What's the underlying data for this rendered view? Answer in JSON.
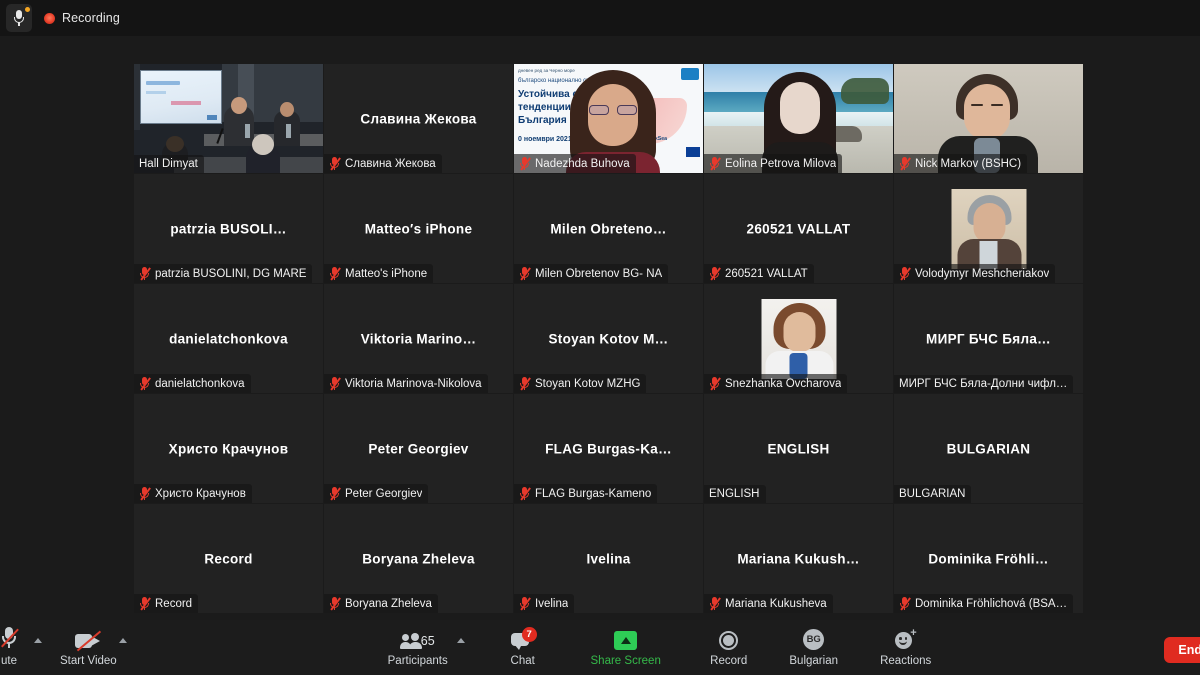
{
  "topbar": {
    "mic_icon": "microphone-icon",
    "recording_dot": "recording-dot-icon",
    "recording_label": "Recording"
  },
  "colors": {
    "active_speaker_border": "#d9e84f",
    "mute_red": "#e8392c",
    "share_green": "#2ecc56",
    "badge_red": "#e02b20",
    "tile_bg": "#222222"
  },
  "gallery": {
    "columns": 5,
    "rows": 5,
    "tiles": [
      {
        "center_name": "",
        "label": "Hall Dimyat",
        "muted": false,
        "kind": "video-hall",
        "active_speaker": true
      },
      {
        "center_name": "Славина Жекова",
        "label": "Славина Жекова",
        "muted": true,
        "kind": "name",
        "active_speaker": false
      },
      {
        "center_name": "",
        "label": "Nadezhda Buhova",
        "muted": true,
        "kind": "video-nadezhda",
        "active_speaker": false
      },
      {
        "center_name": "",
        "label": "Eolina Petrova Milova",
        "muted": true,
        "kind": "video-eolina",
        "active_speaker": false
      },
      {
        "center_name": "",
        "label": "Nick Markov (BSHC)",
        "muted": true,
        "kind": "video-nick",
        "active_speaker": false
      },
      {
        "center_name": "patrzia  BUSOLI…",
        "label": "patrzia BUSOLINI, DG MARE",
        "muted": true,
        "kind": "name",
        "active_speaker": false
      },
      {
        "center_name": "Matteo′s iPhone",
        "label": "Matteo's iPhone",
        "muted": true,
        "kind": "name",
        "active_speaker": false
      },
      {
        "center_name": "Milen  Obreteno…",
        "label": "Milen Obretenov BG- NA",
        "muted": true,
        "kind": "name",
        "active_speaker": false
      },
      {
        "center_name": "260521  VALLAT",
        "label": "260521  VALLAT",
        "muted": true,
        "kind": "name",
        "active_speaker": false
      },
      {
        "center_name": "",
        "label": "Volodymyr Meshcheriakov",
        "muted": true,
        "kind": "photo-volodymyr",
        "active_speaker": false
      },
      {
        "center_name": "danielatchonkova",
        "label": "danielatchonkova",
        "muted": true,
        "kind": "name",
        "active_speaker": false
      },
      {
        "center_name": "Viktoria  Marino…",
        "label": "Viktoria Marinova-Nikolova",
        "muted": true,
        "kind": "name",
        "active_speaker": false
      },
      {
        "center_name": "Stoyan Kotov M…",
        "label": "Stoyan Kotov MZHG",
        "muted": true,
        "kind": "name",
        "active_speaker": false
      },
      {
        "center_name": "",
        "label": "Snezhanka Ovcharova",
        "muted": true,
        "kind": "photo-snezhanka",
        "active_speaker": false
      },
      {
        "center_name": "МИРГ БЧС Бяла…",
        "label": "МИРГ БЧС Бяла-Долни чифл…",
        "muted": false,
        "kind": "name",
        "active_speaker": false
      },
      {
        "center_name": "Христо Крачунов",
        "label": "Христо Крачунов",
        "muted": true,
        "kind": "name",
        "active_speaker": false
      },
      {
        "center_name": "Peter Georgiev",
        "label": "Peter Georgiev",
        "muted": true,
        "kind": "name",
        "active_speaker": false
      },
      {
        "center_name": "FLAG  Burgas-Ka…",
        "label": "FLAG Burgas-Kameno",
        "muted": true,
        "kind": "name",
        "active_speaker": false
      },
      {
        "center_name": "ENGLISH",
        "label": "ENGLISH",
        "muted": false,
        "kind": "name",
        "active_speaker": false
      },
      {
        "center_name": "BULGARIAN",
        "label": "BULGARIAN",
        "muted": false,
        "kind": "name",
        "active_speaker": false
      },
      {
        "center_name": "Record",
        "label": "Record",
        "muted": true,
        "kind": "name",
        "active_speaker": false
      },
      {
        "center_name": "Boryana Zheleva",
        "label": "Boryana Zheleva",
        "muted": true,
        "kind": "name",
        "active_speaker": false
      },
      {
        "center_name": "Ivelina",
        "label": "Ivelina",
        "muted": true,
        "kind": "name",
        "active_speaker": false
      },
      {
        "center_name": "Mariana  Kukush…",
        "label": "Mariana Kukusheva",
        "muted": true,
        "kind": "name",
        "active_speaker": false
      },
      {
        "center_name": "Dominika  Fröhli…",
        "label": "Dominika Fröhlichová (BSA…",
        "muted": true,
        "kind": "name",
        "active_speaker": false
      }
    ]
  },
  "slide": {
    "tiny_top": "дневен ред за Черно море",
    "subtitle": "българско национално събитие",
    "title": "Устойчива синя …<br>тенденции и п…       ед<br>България",
    "date": "0 ноември 2021",
    "hashtag": "#BG4BlackSea"
  },
  "toolbar": {
    "mute": {
      "label": "ute",
      "icon": "microphone-muted-icon"
    },
    "video": {
      "label": "Start Video",
      "icon": "camera-off-icon"
    },
    "participants": {
      "label": "Participants",
      "count": "65",
      "icon": "people-icon"
    },
    "chat": {
      "label": "Chat",
      "badge": "7",
      "icon": "chat-bubble-icon"
    },
    "share": {
      "label": "Share Screen",
      "icon": "share-screen-icon"
    },
    "record": {
      "label": "Record",
      "icon": "record-circle-icon"
    },
    "language": {
      "label": "Bulgarian",
      "badge_text": "BG",
      "icon": "interpretation-icon"
    },
    "reactions": {
      "label": "Reactions",
      "icon": "smiley-plus-icon"
    },
    "leave": {
      "label": "End"
    }
  }
}
